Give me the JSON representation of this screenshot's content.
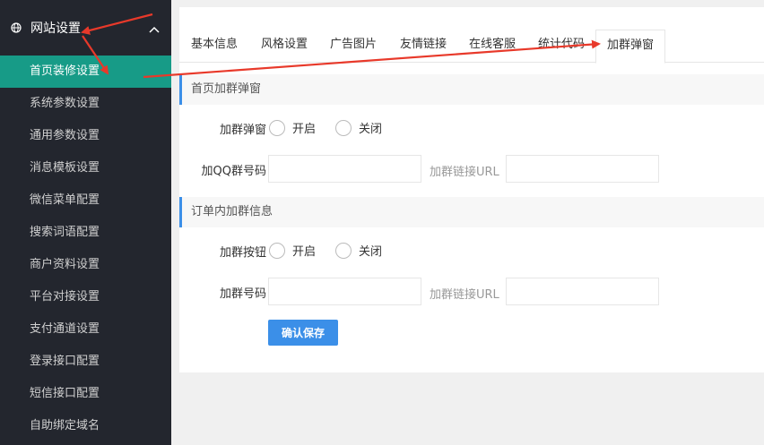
{
  "sidebar": {
    "header": {
      "label": "网站设置",
      "icon": "globe-icon",
      "chevron": "chevron-up-icon"
    },
    "items": [
      {
        "label": "首页装修设置",
        "active": true
      },
      {
        "label": "系统参数设置"
      },
      {
        "label": "通用参数设置"
      },
      {
        "label": "消息模板设置"
      },
      {
        "label": "微信菜单配置"
      },
      {
        "label": "搜索词语配置"
      },
      {
        "label": "商户资料设置"
      },
      {
        "label": "平台对接设置"
      },
      {
        "label": "支付通道设置"
      },
      {
        "label": "登录接口配置"
      },
      {
        "label": "短信接口配置"
      },
      {
        "label": "自助绑定域名"
      }
    ]
  },
  "tabs": [
    {
      "label": "基本信息"
    },
    {
      "label": "风格设置"
    },
    {
      "label": "广告图片"
    },
    {
      "label": "友情链接"
    },
    {
      "label": "在线客服"
    },
    {
      "label": "统计代码"
    },
    {
      "label": "加群弹窗",
      "active": true
    }
  ],
  "section1": {
    "title": "首页加群弹窗",
    "row1": {
      "label": "加群弹窗",
      "option_on": "开启",
      "option_off": "关闭"
    },
    "row2": {
      "label": "加QQ群号码",
      "url_label": "加群链接URL"
    }
  },
  "section2": {
    "title": "订单内加群信息",
    "row1": {
      "label": "加群按钮",
      "option_on": "开启",
      "option_off": "关闭"
    },
    "row2": {
      "label": "加群号码",
      "url_label": "加群链接URL"
    }
  },
  "save_label": "确认保存",
  "colors": {
    "sidebar_bg": "#23262e",
    "active_item": "#179b87",
    "accent": "#3b8fe8",
    "annotation": "#e8392a"
  }
}
